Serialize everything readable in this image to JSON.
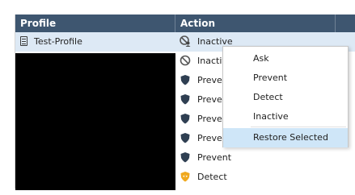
{
  "columns": {
    "profile": "Profile",
    "action": "Action"
  },
  "rows": [
    {
      "profile": "Test-Profile",
      "action": "Inactive",
      "icon": "inactive-user-icon",
      "selected": true
    },
    {
      "profile": "",
      "action": "Inactive",
      "icon": "prohibited-icon"
    },
    {
      "profile": "",
      "action": "Prevent",
      "icon": "shield-icon"
    },
    {
      "profile": "",
      "action": "Prevent",
      "icon": "shield-icon"
    },
    {
      "profile": "",
      "action": "Prevent",
      "icon": "shield-icon"
    },
    {
      "profile": "",
      "action": "Prevent",
      "icon": "shield-icon"
    },
    {
      "profile": "",
      "action": "Prevent",
      "icon": "shield-icon"
    },
    {
      "profile": "",
      "action": "Detect",
      "icon": "detect-shield-icon"
    }
  ],
  "context_menu": {
    "items": [
      "Ask",
      "Prevent",
      "Detect",
      "Inactive",
      "Restore Selected"
    ],
    "highlighted": "Restore Selected"
  },
  "colors": {
    "header_bg": "#3e5670",
    "selected_row_bg": "#dde9f5",
    "menu_highlight_bg": "#cfe6f8",
    "shield_dark": "#2f3f52",
    "detect_orange": "#f0a91e"
  }
}
